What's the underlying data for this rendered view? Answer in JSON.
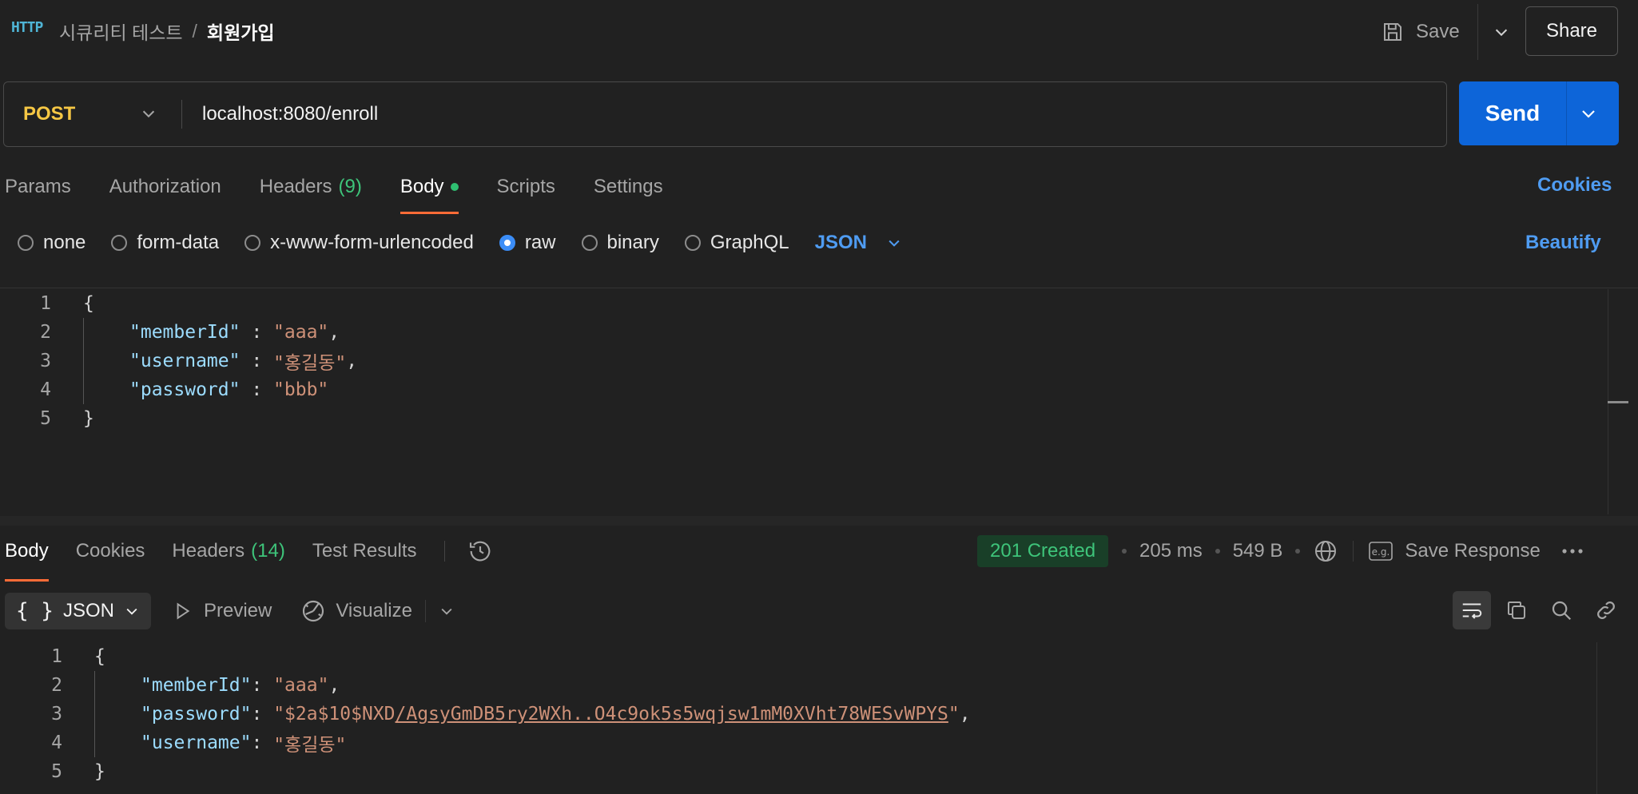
{
  "header": {
    "breadcrumb_collection": "시큐리티 테스트",
    "breadcrumb_separator": "/",
    "breadcrumb_request": "회원가입",
    "save_label": "Save",
    "share_label": "Share",
    "http_logo": "HTTP"
  },
  "request": {
    "method": "POST",
    "url": "localhost:8080/enroll",
    "send_label": "Send"
  },
  "request_tabs": {
    "params": "Params",
    "authorization": "Authorization",
    "headers": "Headers",
    "headers_count": "(9)",
    "body": "Body",
    "scripts": "Scripts",
    "settings": "Settings",
    "cookies": "Cookies"
  },
  "body_types": {
    "none": "none",
    "form_data": "form-data",
    "urlencoded": "x-www-form-urlencoded",
    "raw": "raw",
    "binary": "binary",
    "graphql": "GraphQL",
    "format": "JSON",
    "selected": "raw",
    "beautify": "Beautify"
  },
  "request_body": {
    "line_numbers": [
      "1",
      "2",
      "3",
      "4",
      "5"
    ],
    "open": "{",
    "close": "}",
    "fields": [
      {
        "key": "\"memberId\"",
        "value": "\"aaa\"",
        "trail": ","
      },
      {
        "key": "\"username\"",
        "value": "\"홍길동\"",
        "trail": ","
      },
      {
        "key": "\"password\"",
        "value": "\"bbb\"",
        "trail": ""
      }
    ]
  },
  "response_tabs": {
    "body": "Body",
    "cookies": "Cookies",
    "headers": "Headers",
    "headers_count": "(14)",
    "test_results": "Test Results"
  },
  "response_meta": {
    "status": "201 Created",
    "time": "205 ms",
    "size": "549 B",
    "save_response": "Save Response"
  },
  "response_view": {
    "format": "JSON",
    "preview": "Preview",
    "visualize": "Visualize"
  },
  "response_body": {
    "line_numbers": [
      "1",
      "2",
      "3",
      "4",
      "5"
    ],
    "open": "{",
    "close": "}",
    "member_key": "\"memberId\"",
    "member_value": "\"aaa\"",
    "password_key": "\"password\"",
    "password_value_prefix": "\"$2a$10$NXD",
    "password_value_link": "/AgsyGmDB5ry2WXh..O4c9ok5s5wqjsw1mM0XVht78WESvWPYS",
    "password_value_suffix": "\"",
    "username_key": "\"username\"",
    "username_value": "\"홍길동\""
  },
  "colors": {
    "accent_orange": "#ff6c37",
    "send_blue": "#0d65d9",
    "method_yellow": "#f6c744",
    "status_green": "#3ec47a"
  }
}
